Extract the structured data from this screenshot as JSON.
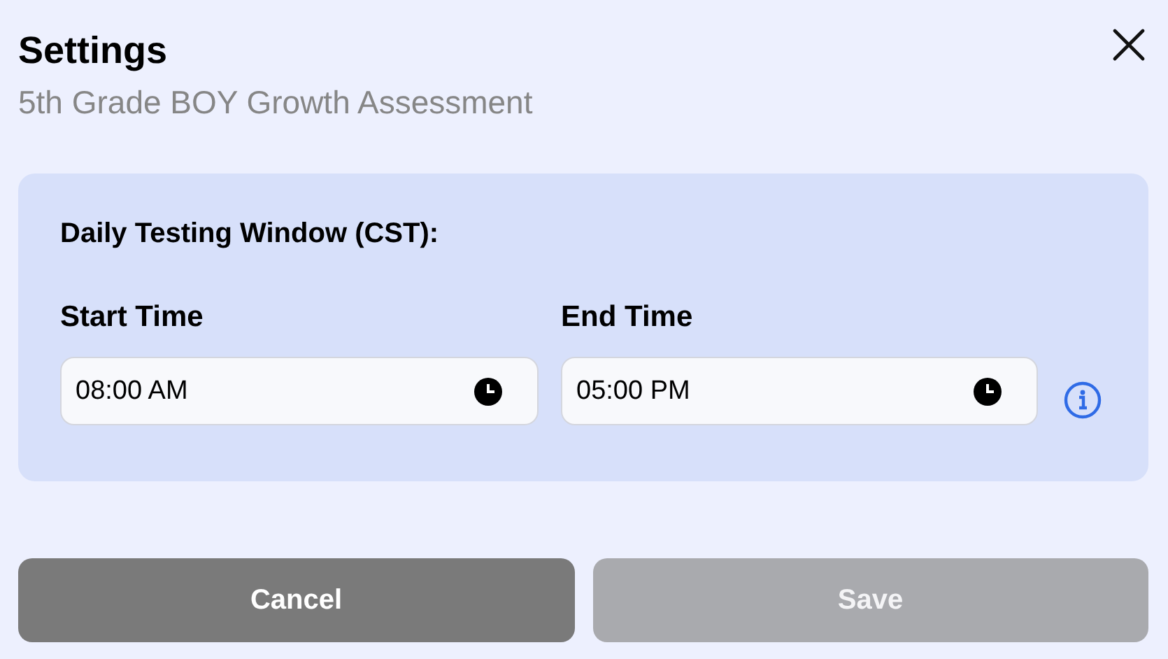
{
  "dialog": {
    "title": "Settings",
    "subtitle": "5th Grade BOY Growth Assessment"
  },
  "panel": {
    "heading": "Daily Testing Window (CST):",
    "fields": [
      {
        "label": "Start Time",
        "value": "08:00 AM"
      },
      {
        "label": "End Time",
        "value": "05:00 PM"
      }
    ]
  },
  "buttons": [
    {
      "label": "Cancel",
      "kind": "secondary",
      "disabled": false
    },
    {
      "label": "Save",
      "kind": "primary",
      "disabled": true
    }
  ]
}
